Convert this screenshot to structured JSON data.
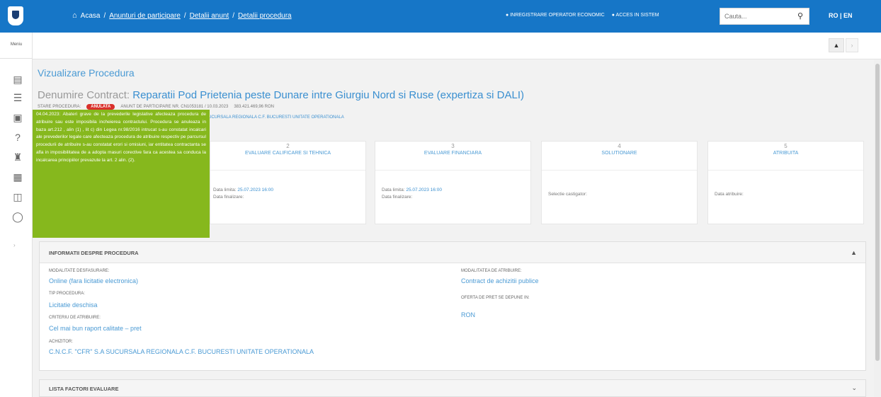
{
  "header": {
    "home_label": "Acasa",
    "breadcrumbs": [
      "Anunturi de participare",
      "Detalii anunt",
      "Detalii procedura"
    ],
    "link_register": "INREGISTRARE OPERATOR ECONOMIC",
    "link_login": "ACCES IN SISTEM",
    "search_placeholder": "Cauta...",
    "lang": "RO | EN"
  },
  "sidebar": {
    "menu_label": "Meniu"
  },
  "page": {
    "title": "Vizualizare Procedura",
    "contract_label": "Denumire Contract:",
    "contract_name": "Reparatii Pod Prietenia peste Dunare intre Giurgiu Nord si Ruse (expertiza si DALI)",
    "status_label": "STARE PROCEDURA:",
    "status_badge": "ANULATA",
    "notice_ref": "ANUNT DE PARTICIPARE NR. CN1053181 / 10.03.2023",
    "estimated_value": "383.421.469,96 RON",
    "authority": "SUCURSALA REGIONALA C.F. BUCURESTI UNITATE OPERATIONALA"
  },
  "tooltip": {
    "text": "04.04.2023: Abateri grave de la prevederile legislative afecteaza procedura de atribuire sau este imposibila incheierea contractului. Procedura se anuleaza in baza art.212 , alin (1) , lit c) din Legea nr.98/2016 intrucat s-au constatat incalcari ale prevederilor legale care afecteaza procedura de atribuire respectiv pe parcursul procedurii de atribuire s-au constatat erori si omisiuni, iar entitatea contractanta se afla in imposibilitatea de a adopta masuri corective fara ca acestea sa conduca la incalcarea principiilor prevazute la art. 2 alin. (2)."
  },
  "stages": [
    {
      "number": "2",
      "name": "EVALUARE CALIFICARE SI TEHNICA",
      "limit_label": "Data limita:",
      "limit_date": "25.07.2023 16:00",
      "final_label": "Data finalizare:"
    },
    {
      "number": "3",
      "name": "EVALUARE FINANCIARA",
      "limit_label": "Data limita:",
      "limit_date": "25.07.2023 16:00",
      "final_label": "Data finalizare:"
    },
    {
      "number": "4",
      "name": "SOLUTIONARE",
      "text": "Selectie castigator:"
    },
    {
      "number": "5",
      "name": "ATRIBUITA",
      "text": "Data atribuire:"
    }
  ],
  "info_panel": {
    "title": "INFORMATII DESPRE PROCEDURA",
    "mod_label": "MODALITATE DESFASURARE:",
    "mod_value": "Online (fara licitatie electronica)",
    "type_label": "TIP PROCEDURA:",
    "type_value": "Licitatie deschisa",
    "criteria_label": "CRITERIU DE ATRIBUIRE:",
    "criteria_value": "Cel mai bun raport calitate – pret",
    "buyer_label": "ACHIZITOR:",
    "buyer_value": "C.N.C.F. \"CFR\" S.A SUCURSALA REGIONALA C.F. BUCURESTI UNITATE OPERATIONALA",
    "award_label": "MODALITATEA DE ATRIBUIRE:",
    "award_value": "Contract de achizitii publice",
    "currency_label": "OFERTA DE PRET SE DEPUNE IN:",
    "currency_value": "RON"
  },
  "factors_panel": {
    "title": "LISTA FACTORI EVALUARE"
  }
}
